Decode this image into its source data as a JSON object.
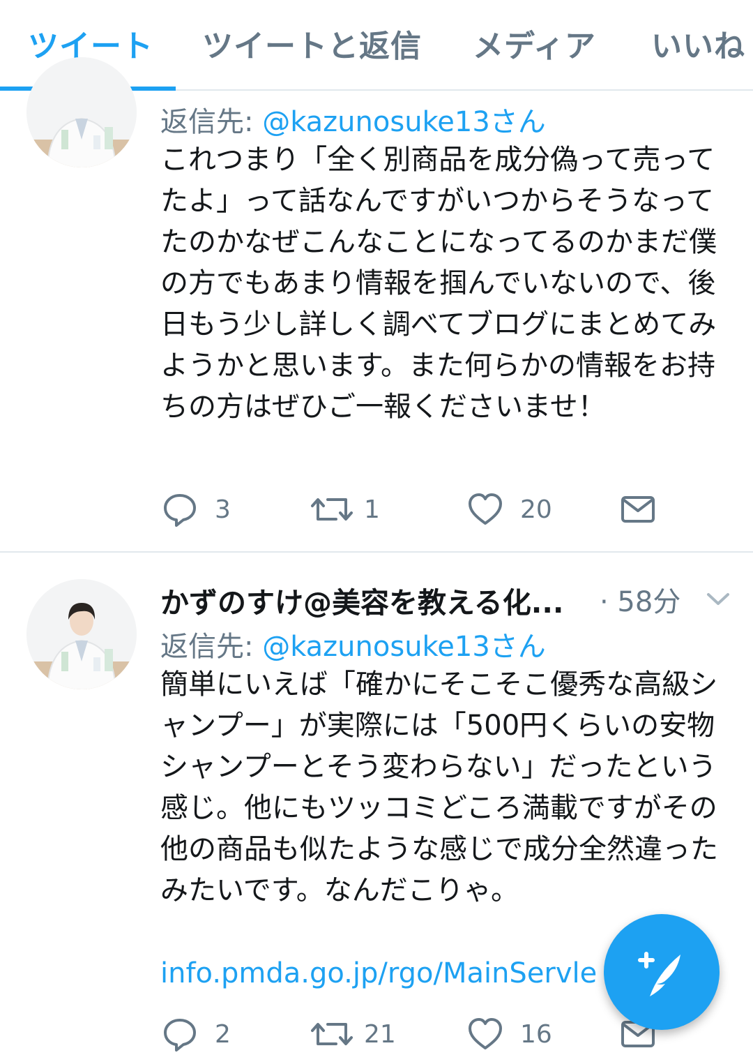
{
  "tabs": [
    "ツイート",
    "ツイートと返信",
    "メディア",
    "いいね"
  ],
  "colors": {
    "accent": "#1da1f2",
    "muted": "#657786",
    "divider": "#e1e8ed"
  },
  "tweets": [
    {
      "reply_label": "返信先:",
      "reply_handle": "@kazunosuke13さん",
      "text": "これつまり「全く別商品を成分偽って売ってたよ」って話なんですがいつからそうなってたのかなぜこんなことになってるのかまだ僕の方でもあまり情報を掴んでいないので、後日もう少し詳しく調べてブログにまとめてみようかと思います。また何らかの情報をお持ちの方はぜひご一報くださいませ！",
      "replies": "3",
      "retweets": "1",
      "likes": "20"
    },
    {
      "author": "かずのすけ@美容を教える化...",
      "time": "· 58分",
      "reply_label": "返信先:",
      "reply_handle": "@kazunosuke13さん",
      "text": "簡単にいえば「確かにそこそこ優秀な高級シャンプー」が実際には「500円くらいの安物シャンプーとそう変わらない」だったという感じ。他にもツッコミどころ満載ですがその他の商品も似たような感じで成分全然違ったみたいです。なんだこりゃ。",
      "link": "info.pmda.go.jp/rgo/MainServle",
      "replies": "2",
      "retweets": "21",
      "likes": "16"
    }
  ],
  "icons": [
    "reply-icon",
    "retweet-icon",
    "like-icon",
    "dm-icon",
    "chevron-down-icon",
    "compose-tweet-icon"
  ]
}
